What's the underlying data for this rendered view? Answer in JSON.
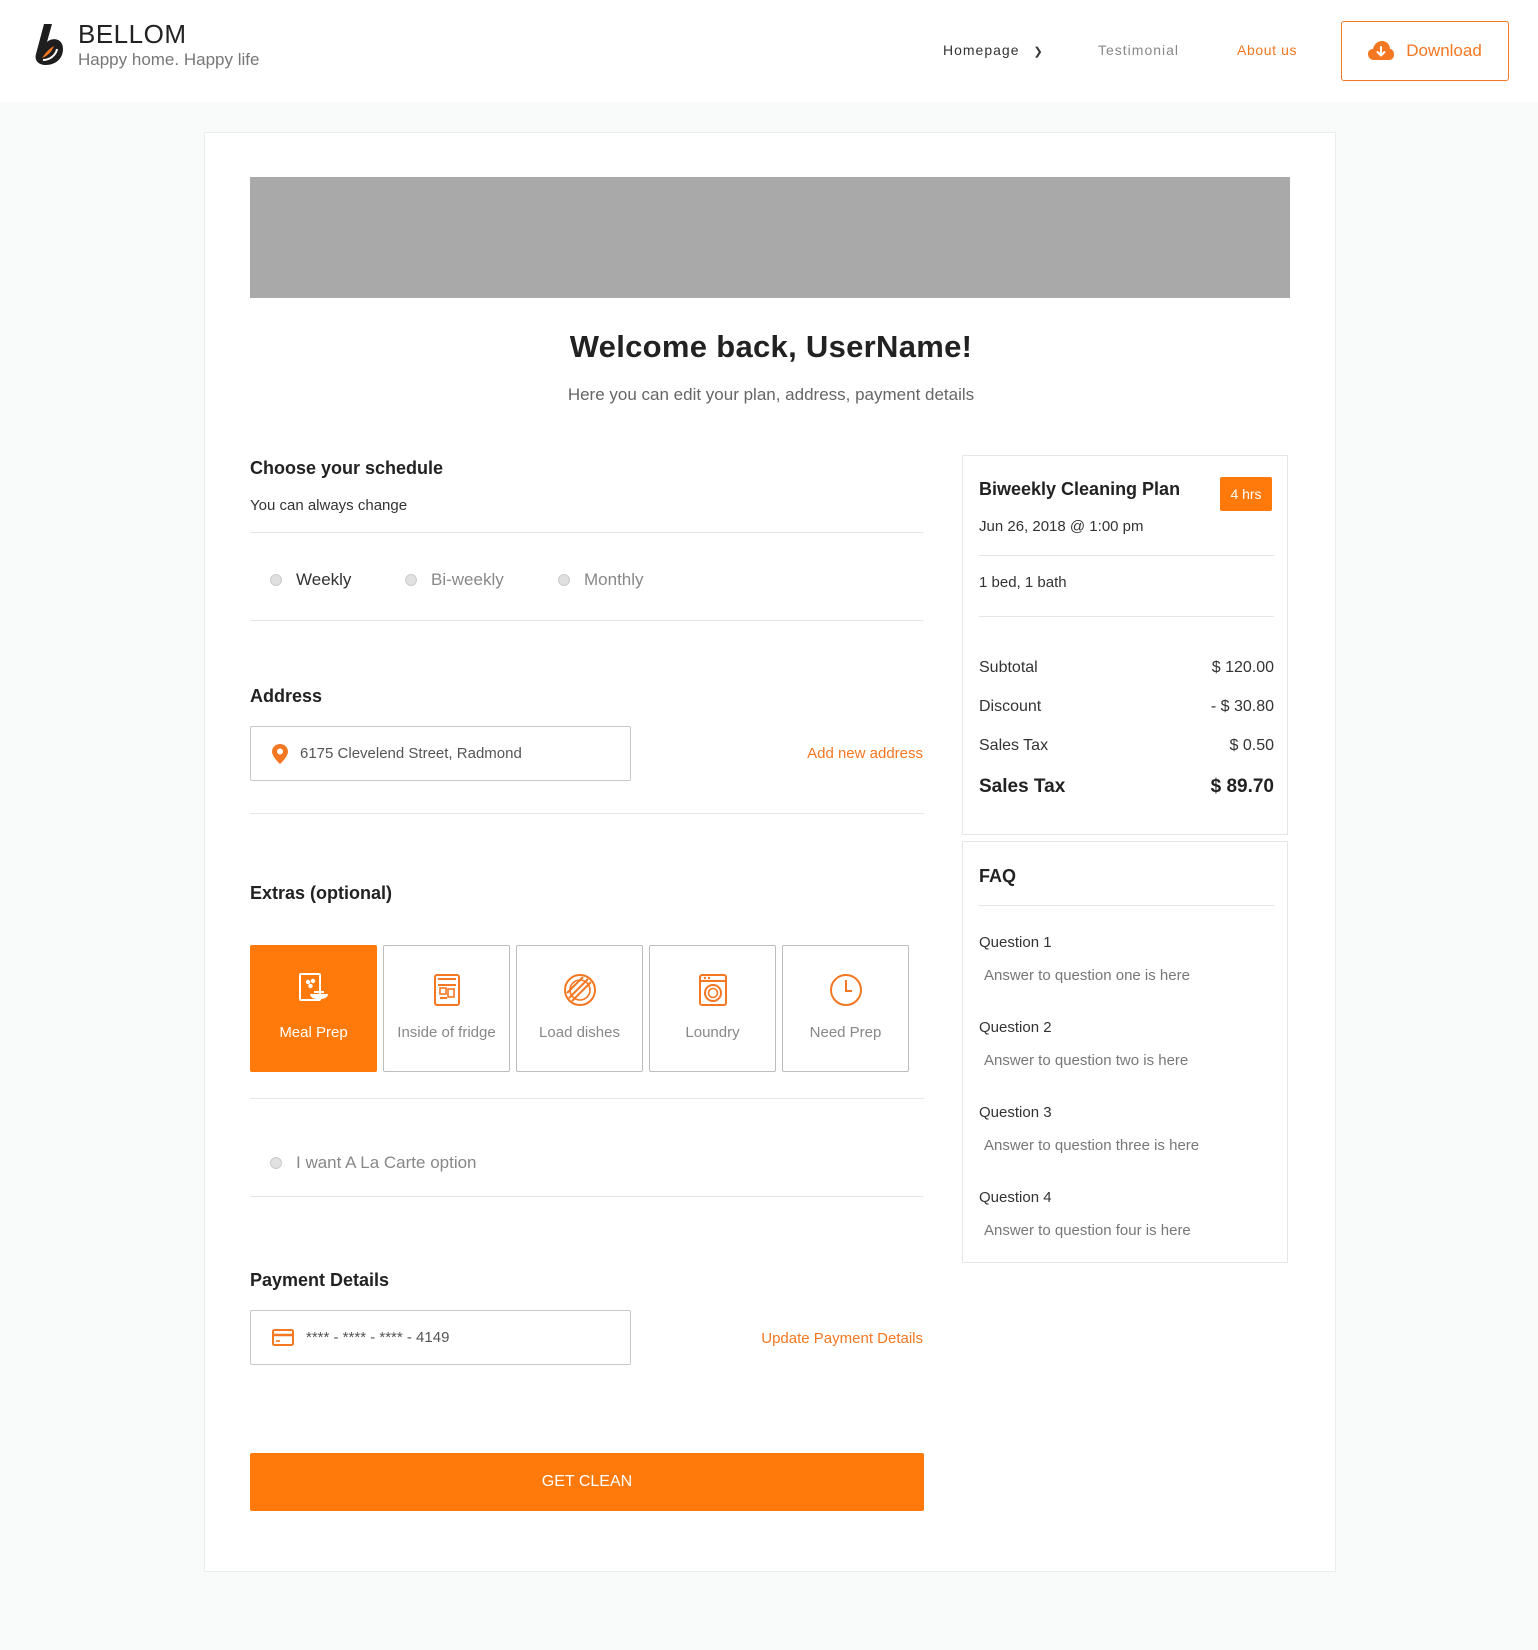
{
  "brand": {
    "name": "BELLOM",
    "tagline": "Happy home. Happy life"
  },
  "nav": {
    "homepage": "Homepage",
    "testimonial": "Testimonial",
    "about": "About us",
    "download": "Download"
  },
  "welcome": {
    "title": "Welcome back, UserName!",
    "subtitle": "Here you can edit your plan, address, payment details"
  },
  "schedule": {
    "title": "Choose your schedule",
    "subtitle": "You can always change",
    "options": [
      "Weekly",
      "Bi-weekly",
      "Monthly"
    ]
  },
  "address": {
    "title": "Address",
    "value": "6175 Clevelend Street, Radmond",
    "add_link": "Add new address"
  },
  "extras": {
    "title": "Extras (optional)",
    "items": [
      {
        "label": "Meal Prep",
        "icon": "meal-prep-icon",
        "active": true
      },
      {
        "label": "Inside of fridge",
        "icon": "fridge-icon",
        "active": false
      },
      {
        "label": "Load dishes",
        "icon": "dishes-icon",
        "active": false
      },
      {
        "label": "Loundry",
        "icon": "laundry-icon",
        "active": false
      },
      {
        "label": "Need Prep",
        "icon": "clock-icon",
        "active": false
      }
    ],
    "alacarte": "I want A La Carte option"
  },
  "payment": {
    "title": "Payment Details",
    "card": "**** - **** - **** - 4149",
    "update_link": "Update Payment Details"
  },
  "cta": "GET CLEAN",
  "plan": {
    "title": "Biweekly Cleaning Plan",
    "badge": "4 hrs",
    "date": "Jun 26, 2018 @ 1:00 pm",
    "rooms": "1 bed, 1 bath",
    "subtotal_label": "Subtotal",
    "subtotal_value": "$ 120.00",
    "discount_label": "Discount",
    "discount_value": "- $ 30.80",
    "tax_label": "Sales Tax",
    "tax_value": "$ 0.50",
    "total_label": "Sales Tax",
    "total_value": "$ 89.70"
  },
  "faq": {
    "title": "FAQ",
    "items": [
      {
        "q": "Question 1",
        "a": "Answer to question one is here"
      },
      {
        "q": "Question 2",
        "a": "Answer to question two is here"
      },
      {
        "q": "Question 3",
        "a": "Answer to question three is here"
      },
      {
        "q": "Question 4",
        "a": "Answer to question four is here"
      }
    ]
  },
  "colors": {
    "accent": "#ff7a0a",
    "link": "#f47721",
    "banner": "#a9a9a9"
  }
}
